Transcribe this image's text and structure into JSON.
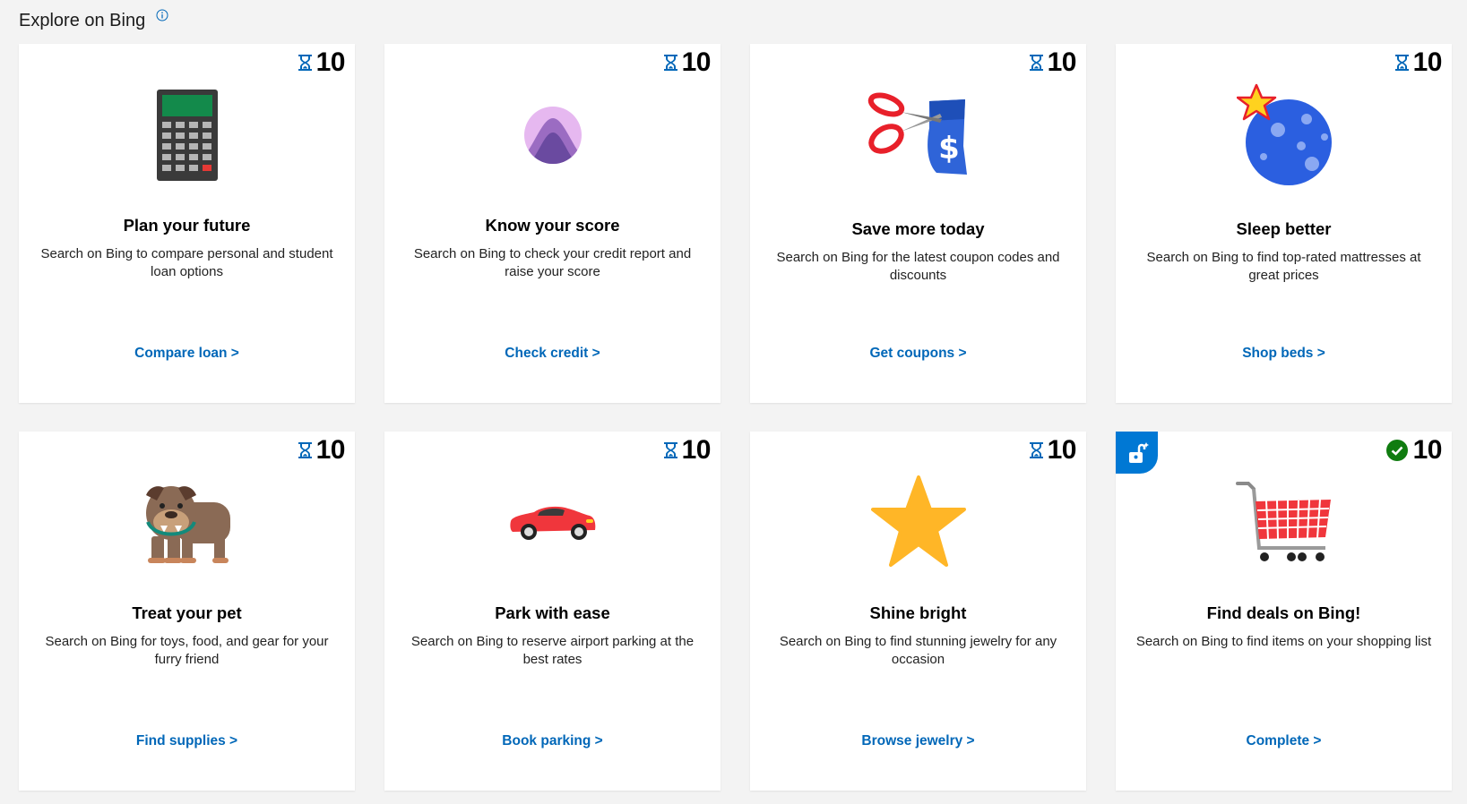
{
  "header": {
    "title": "Explore on Bing"
  },
  "cards": [
    {
      "points": "10",
      "title": "Plan your future",
      "description": "Search on Bing to compare personal and student loan options",
      "link": "Compare loan >",
      "status": "pending"
    },
    {
      "points": "10",
      "title": "Know your score",
      "description": "Search on Bing to check your credit report and raise your score",
      "link": "Check credit >",
      "status": "pending"
    },
    {
      "points": "10",
      "title": "Save more today",
      "description": "Search on Bing for the latest coupon codes and discounts",
      "link": "Get coupons >",
      "status": "pending"
    },
    {
      "points": "10",
      "title": "Sleep better",
      "description": "Search on Bing to find top-rated mattresses at great prices",
      "link": "Shop beds >",
      "status": "pending"
    },
    {
      "points": "10",
      "title": "Treat your pet",
      "description": "Search on Bing for toys, food, and gear for your furry friend",
      "link": "Find supplies >",
      "status": "pending"
    },
    {
      "points": "10",
      "title": "Park with ease",
      "description": "Search on Bing to reserve airport parking at the best rates",
      "link": "Book parking >",
      "status": "pending"
    },
    {
      "points": "10",
      "title": "Shine bright",
      "description": "Search on Bing to find stunning jewelry for any occasion",
      "link": "Browse jewelry >",
      "status": "pending"
    },
    {
      "points": "10",
      "title": "Find deals on Bing!",
      "description": "Search on Bing to find items on your shopping list",
      "link": "Complete >",
      "status": "completed"
    }
  ],
  "icons": {
    "pending": "hourglass-icon",
    "completed": "check-circle-icon",
    "info": "info-icon",
    "unlocked": "unlock-icon"
  },
  "colors": {
    "link": "#0067b8",
    "badge_blue": "#0078d4",
    "check_green": "#107c10"
  }
}
